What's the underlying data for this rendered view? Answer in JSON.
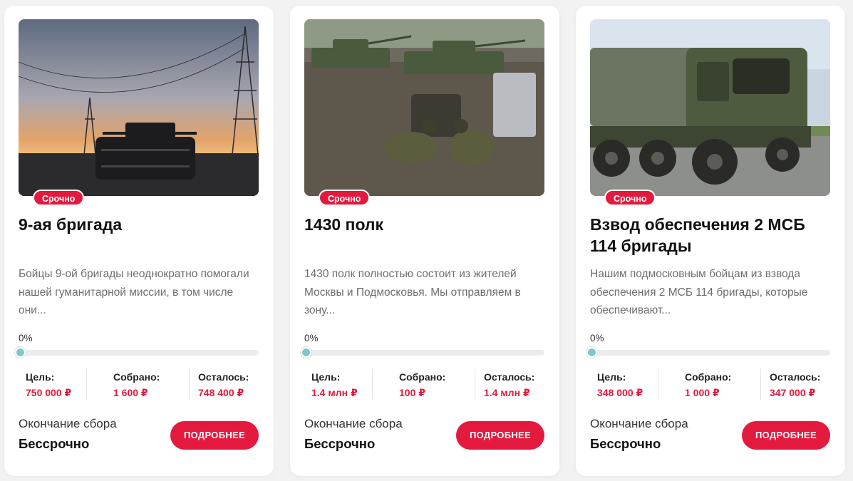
{
  "colors": {
    "accent": "#e3193e",
    "progress": "#7ec8cc",
    "track": "#ececec"
  },
  "cards": [
    {
      "photo": "drone-case-power-lines-sunset-photo",
      "badge": "Срочно",
      "title": "9-ая бригада",
      "description": "Бойцы 9-ой бригады неоднократно помогали нашей гуманитарной миссии, в том числе они...",
      "progress_text": "0%",
      "progress": 0,
      "stats": [
        {
          "label": "Цель:",
          "value": "750 000 ₽"
        },
        {
          "label": "Собрано:",
          "value": "1 600 ₽"
        },
        {
          "label": "Осталось:",
          "value": "748 400 ₽"
        }
      ],
      "end_label": "Окончание сбора",
      "end_value": "Бессрочно",
      "button": "ПОДРОБНЕЕ"
    },
    {
      "photo": "tanks-soldiers-engine-repair-photo",
      "badge": "Срочно",
      "title": "1430 полк",
      "description": "1430 полк полностью состоит из жителей Москвы и Подмосковья. Мы отправляем в зону...",
      "progress_text": "0%",
      "progress": 0,
      "stats": [
        {
          "label": "Цель:",
          "value": "1.4 млн ₽"
        },
        {
          "label": "Собрано:",
          "value": "100 ₽"
        },
        {
          "label": "Осталось:",
          "value": "1.4 млн ₽"
        }
      ],
      "end_label": "Окончание сбора",
      "end_value": "Бессрочно",
      "button": "ПОДРОБНЕЕ"
    },
    {
      "photo": "military-kamaz-truck-photo",
      "badge": "Срочно",
      "title": "Взвод обеспечения 2 МСБ 114 бригады",
      "description": "Нашим подмосковным бойцам из взвода обеспечения 2 МСБ 114 бригады, которые обеспечивают...",
      "progress_text": "0%",
      "progress": 0,
      "stats": [
        {
          "label": "Цель:",
          "value": "348 000 ₽"
        },
        {
          "label": "Собрано:",
          "value": "1 000 ₽"
        },
        {
          "label": "Осталось:",
          "value": "347 000 ₽"
        }
      ],
      "end_label": "Окончание сбора",
      "end_value": "Бессрочно",
      "button": "ПОДРОБНЕЕ"
    }
  ]
}
